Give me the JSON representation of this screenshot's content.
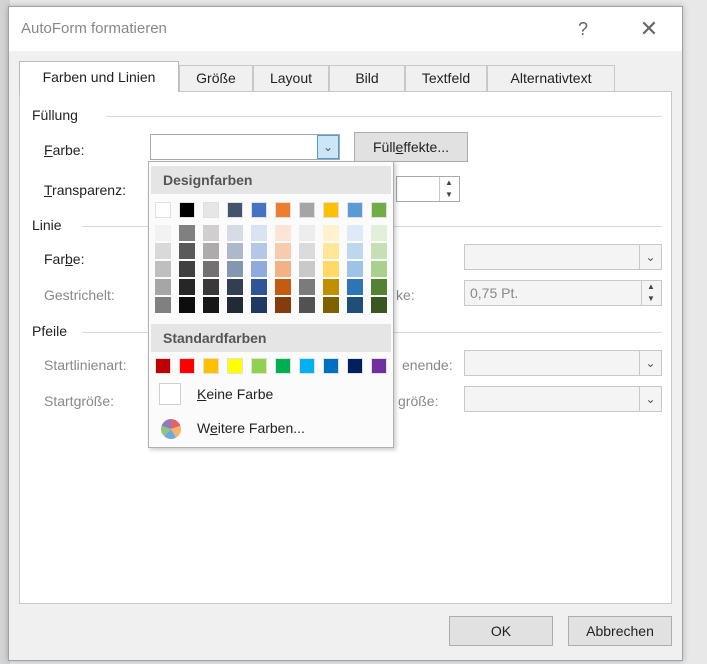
{
  "window": {
    "title": "AutoForm formatieren",
    "help_glyph": "?",
    "close_glyph": "✕"
  },
  "tabs": [
    "Farben und Linien",
    "Größe",
    "Layout",
    "Bild",
    "Textfeld",
    "Alternativtext"
  ],
  "fill": {
    "group": "Füllung",
    "color_label_pre": "",
    "color_label_u": "F",
    "color_label_post": "arbe:",
    "effects_pre": "Füll",
    "effects_u": "e",
    "effects_post": "ffekte...",
    "transparency_pre": "",
    "transparency_u": "T",
    "transparency_post": "ransparenz:"
  },
  "line": {
    "group": "Linie",
    "color_pre": "Far",
    "color_u": "b",
    "color_post": "e:",
    "dashed_label": "Gestrichelt:",
    "weight_label_partial": "ke:",
    "weight_value": "0,75 Pt."
  },
  "arrows": {
    "group": "Pfeile",
    "start_style_label": "Startlinienart:",
    "end_style_label_partial": "enende:",
    "start_size_label": "Startgröße:",
    "end_size_label_partial": "größe:"
  },
  "palette": {
    "design_header": "Designfarben",
    "standard_header": "Standardfarben",
    "no_color_pre": "",
    "no_color_u": "K",
    "no_color_post": "eine Farbe",
    "more_colors_pre": "W",
    "more_colors_u": "e",
    "more_colors_post": "itere Farben...",
    "theme_top": [
      "#ffffff",
      "#000000",
      "#e7e6e6",
      "#44546a",
      "#4472c4",
      "#ed7d31",
      "#a5a5a5",
      "#ffc000",
      "#5b9bd5",
      "#70ad47"
    ],
    "theme_shades": [
      [
        "#f2f2f2",
        "#d9d9d9",
        "#bfbfbf",
        "#a6a6a6",
        "#808080"
      ],
      [
        "#808080",
        "#595959",
        "#404040",
        "#262626",
        "#0d0d0d"
      ],
      [
        "#d0cece",
        "#aeabab",
        "#757171",
        "#3a3838",
        "#171616"
      ],
      [
        "#d6dce5",
        "#adb9ca",
        "#8497b0",
        "#333f50",
        "#222a35"
      ],
      [
        "#dae3f3",
        "#b4c7e7",
        "#8faadc",
        "#2f5597",
        "#1f3864"
      ],
      [
        "#fbe5d6",
        "#f8cbad",
        "#f4b183",
        "#c55a11",
        "#843c0c"
      ],
      [
        "#ededed",
        "#dbdbdb",
        "#c9c9c9",
        "#7b7b7b",
        "#525252"
      ],
      [
        "#fff2cc",
        "#ffe699",
        "#ffd966",
        "#bf9000",
        "#7f6000"
      ],
      [
        "#deebf7",
        "#bdd7ee",
        "#9dc3e6",
        "#2e75b6",
        "#1f4e79"
      ],
      [
        "#e2f0d9",
        "#c5e0b4",
        "#a9d18e",
        "#548235",
        "#385723"
      ]
    ],
    "standard": [
      "#c00000",
      "#ff0000",
      "#ffc000",
      "#ffff00",
      "#92d050",
      "#00b050",
      "#00b0f0",
      "#0070c0",
      "#002060",
      "#7030a0"
    ]
  },
  "buttons": {
    "ok": "OK",
    "cancel": "Abbrechen"
  }
}
